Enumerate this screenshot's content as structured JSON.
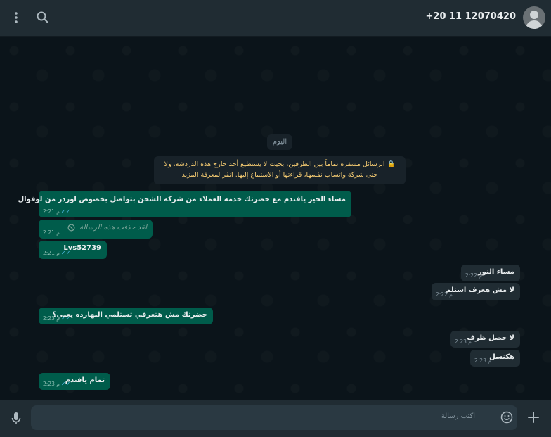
{
  "header": {
    "contact_name": "+20 11 12070420",
    "icons": [
      "menu-icon",
      "search-icon",
      "avatar"
    ]
  },
  "chat": {
    "date_chip": "اليوم",
    "encryption_notice": "🔒 الرسائل مشفرة تماماً بين الطرفين، بحيث لا يستطيع أحد خارج هذه الدردشة، ولا حتى شركة واتساب نفسها، قراءتها أو الاستماع إليها. انقر لمعرفة المزيد",
    "messages": [
      {
        "direction": "out",
        "text": "مساء الخير يافندم مع حضرتك خدمه العملاء من شركه الشحن بتواصل بخصوص اوردر من لوفوال",
        "time": "2:21 م",
        "status": "read"
      },
      {
        "direction": "out",
        "text": "لقد حذفت هذه الرسالة",
        "time": "2:21 م",
        "deleted": true
      },
      {
        "direction": "out",
        "text": "Lvs52739",
        "time": "2:21 م",
        "status": "read"
      },
      {
        "direction": "in",
        "text": "مساء النور",
        "time": "2:22 م"
      },
      {
        "direction": "in",
        "text": "لا مش هعرف استلم",
        "time": "2:22 م"
      },
      {
        "direction": "out",
        "text": "حضرتك مش هتعرفي تستلمي النهارده يعني؟",
        "time": "2:23 م",
        "status": "read"
      },
      {
        "direction": "in",
        "text": "لا حصل ظرف",
        "time": "2:23 م"
      },
      {
        "direction": "in",
        "text": "هكنسل",
        "time": "2:23 م"
      },
      {
        "direction": "out",
        "text": "تمام يافندم",
        "time": "2:23 م",
        "status": "read"
      }
    ]
  },
  "footer": {
    "placeholder": "اكتب رسالة",
    "icons": [
      "mic-icon",
      "emoji-icon",
      "plus-icon"
    ]
  },
  "colors": {
    "outgoing_bubble": "#005c4b",
    "incoming_bubble": "#202c33",
    "background": "#0b141a",
    "read_tick": "#53bdeb"
  }
}
